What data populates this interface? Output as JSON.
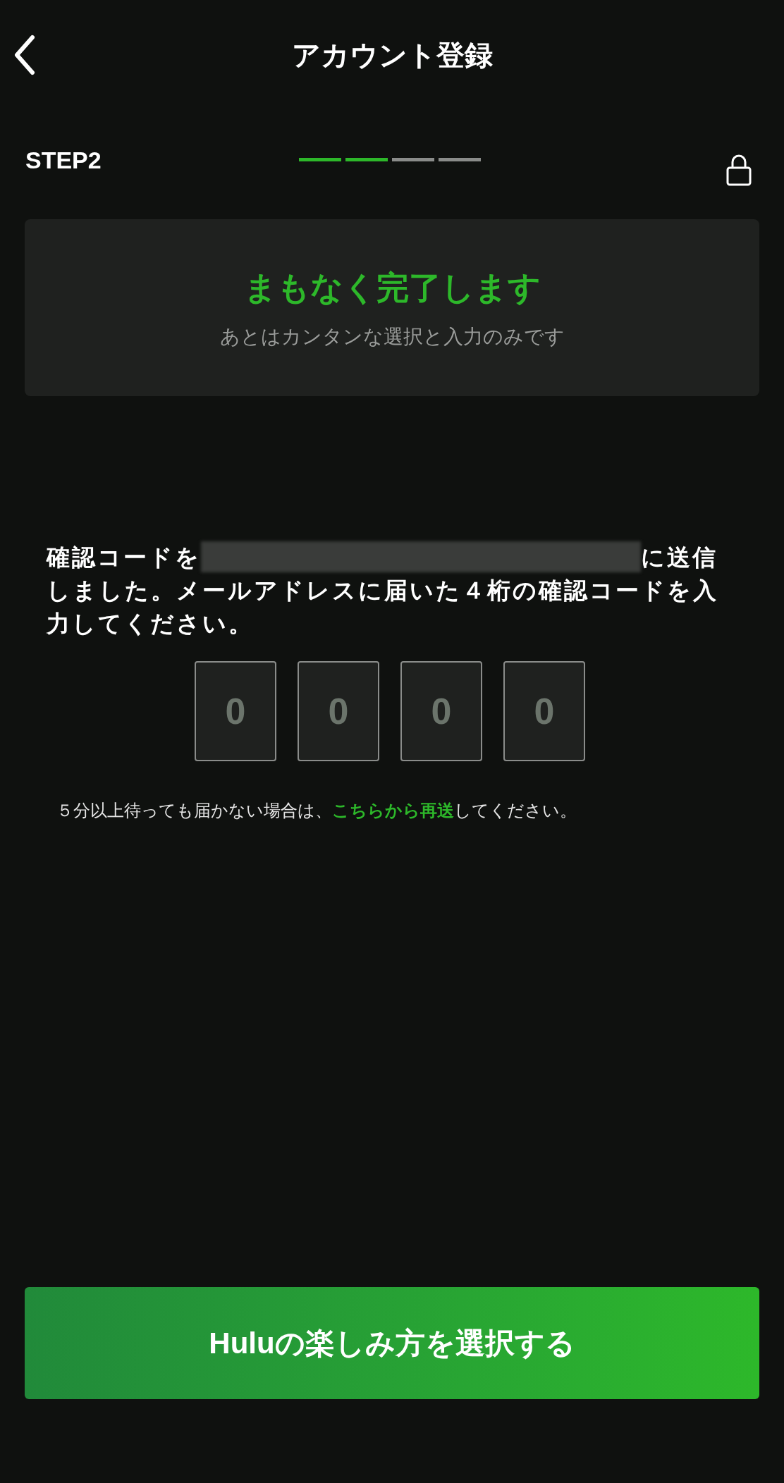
{
  "header": {
    "title": "アカウント登録"
  },
  "step": {
    "label": "STEP2",
    "segments": [
      {
        "done": true
      },
      {
        "done": true
      },
      {
        "done": false
      },
      {
        "done": false
      }
    ]
  },
  "banner": {
    "title": "まもなく完了します",
    "subtitle": "あとはカンタンな選択と入力のみです"
  },
  "message": {
    "before": "確認コードを",
    "email_redacted": true,
    "after": "に送信しました。メールアドレスに届いた４桁の確認コードを入力してください。"
  },
  "code_fields": [
    {
      "placeholder": "0"
    },
    {
      "placeholder": "0"
    },
    {
      "placeholder": "0"
    },
    {
      "placeholder": "0"
    }
  ],
  "resend": {
    "before": "５分以上待っても届かない場合は、",
    "link": "こちらから再送",
    "after": "してください。"
  },
  "primary_button": {
    "label": "Huluの楽しみ方を選択する"
  }
}
